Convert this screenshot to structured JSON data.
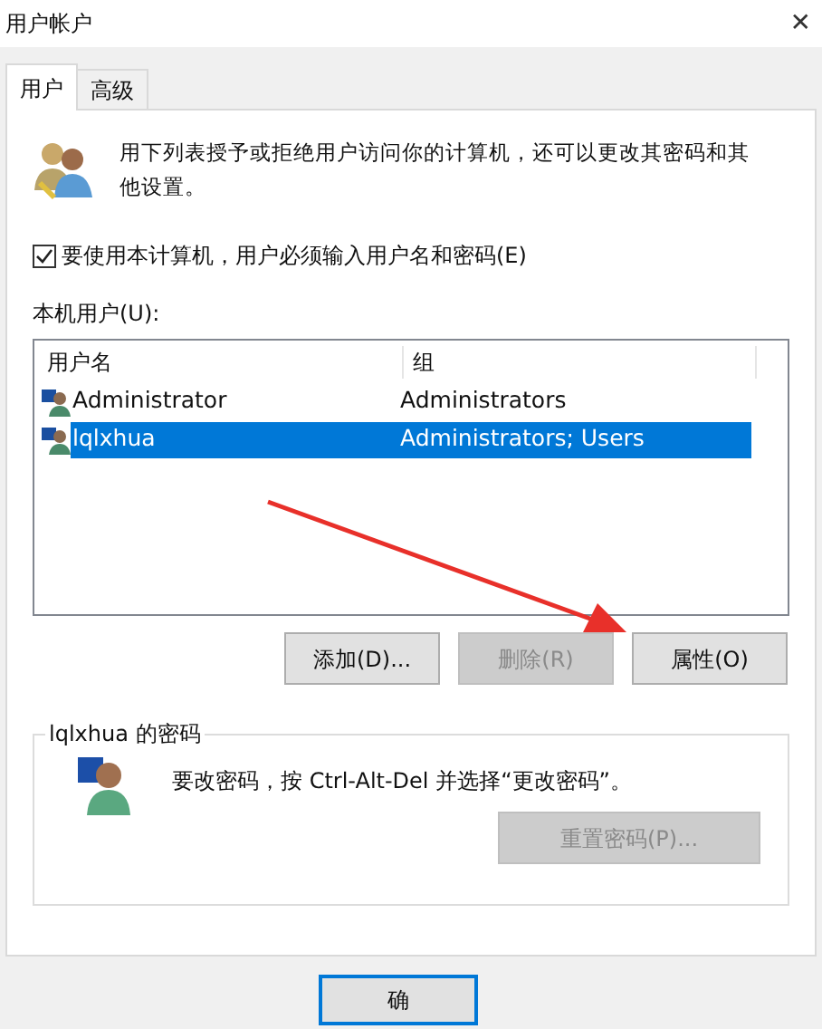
{
  "window": {
    "title": "用户帐户",
    "close": "✕"
  },
  "tabs": [
    {
      "label": "用户",
      "selected": true
    },
    {
      "label": "高级",
      "selected": false
    }
  ],
  "intro": "用下列表授予或拒绝用户访问你的计算机，还可以更改其密码和其他设置。",
  "require_login": {
    "label": "要使用本计算机，用户必须输入用户名和密码(E)",
    "checked": true
  },
  "users_label": "本机用户(U):",
  "table": {
    "columns": [
      "用户名",
      "组"
    ],
    "rows": [
      {
        "name": "Administrator",
        "group": "Administrators",
        "selected": false
      },
      {
        "name": "lqlxhua",
        "group": "Administrators; Users",
        "selected": true
      }
    ]
  },
  "user_buttons": [
    {
      "label": "添加(D)...",
      "disabled": false
    },
    {
      "label": "删除(R)",
      "disabled": true
    },
    {
      "label": "属性(O)",
      "disabled": false
    }
  ],
  "password_group": {
    "title": "lqlxhua 的密码",
    "text": "要改密码，按 Ctrl-Alt-Del 并选择“更改密码”。",
    "reset_button": {
      "label": "重置密码(P)...",
      "disabled": true
    }
  },
  "footer_buttons": [
    {
      "label": "确",
      "disabled": false
    }
  ]
}
